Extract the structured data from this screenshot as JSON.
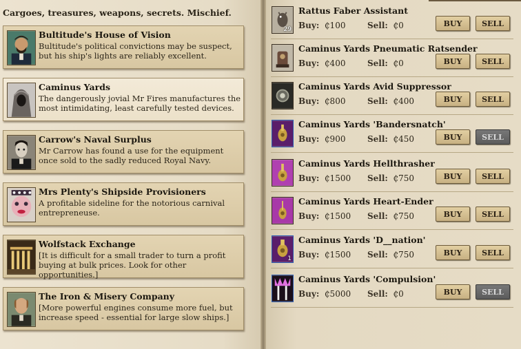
{
  "tagline": "Cargoes, treasures, weapons, secrets. Mischief.",
  "shops": [
    {
      "name": "Bultitude's House of Vision",
      "desc": "Bultitude's political convictions may be suspect, but his ship's lights are reliably excellent.",
      "portrait": "bearded-man-portrait"
    },
    {
      "name": "Caminus Yards",
      "desc": "The dangerously jovial Mr Fires manufactures the most intimidating, least carefully tested devices.",
      "portrait": "hooded-figure-portrait"
    },
    {
      "name": "Carrow's Naval Surplus",
      "desc": "Mr Carrow has found a use for the equipment once sold to the sadly reduced Royal Navy.",
      "portrait": "pale-man-portrait"
    },
    {
      "name": "Mrs Plenty's Shipside Provisioners",
      "desc": "A profitable sideline for the notorious carnival entrepreneuse.",
      "portrait": "clown-woman-portrait"
    },
    {
      "name": "Wolfstack Exchange",
      "desc": "[It is difficult for a small trader to turn a profit buying at bulk prices. Look for other opportunities.]",
      "portrait": "exchange-building-portrait"
    },
    {
      "name": "The Iron & Misery Company",
      "desc": "[More powerful engines consume more fuel, but increase speed - essential for large slow ships.]",
      "portrait": "balding-man-portrait"
    }
  ],
  "labels": {
    "buy": "Buy:",
    "sell": "Sell:",
    "buy_btn": "BUY",
    "sell_btn": "SELL"
  },
  "items": [
    {
      "name": "Rattus Faber Assistant",
      "buy": "₵100",
      "sell": "₵0",
      "qty": "29",
      "icon": "rat-assistant-icon",
      "sell_enabled": true
    },
    {
      "name": "Caminus Yards Pneumatic Ratsender",
      "buy": "₵400",
      "sell": "₵0",
      "qty": "",
      "icon": "ratsender-icon",
      "sell_enabled": true
    },
    {
      "name": "Caminus Yards Avid Suppressor",
      "buy": "₵800",
      "sell": "₵400",
      "qty": "",
      "icon": "suppressor-icon",
      "sell_enabled": true
    },
    {
      "name": "Caminus Yards 'Bandersnatch'",
      "buy": "₵900",
      "sell": "₵450",
      "qty": "",
      "icon": "bandersnatch-icon",
      "sell_enabled": false
    },
    {
      "name": "Caminus Yards Hellthrasher",
      "buy": "₵1500",
      "sell": "₵750",
      "qty": "",
      "icon": "hellthrasher-icon",
      "sell_enabled": true
    },
    {
      "name": "Caminus Yards Heart-Ender",
      "buy": "₵1500",
      "sell": "₵750",
      "qty": "",
      "icon": "heart-ender-icon",
      "sell_enabled": true
    },
    {
      "name": "Caminus Yards 'D__nation'",
      "buy": "₵1500",
      "sell": "₵750",
      "qty": "1",
      "icon": "damnation-icon",
      "sell_enabled": true
    },
    {
      "name": "Caminus Yards 'Compulsion'",
      "buy": "₵5000",
      "sell": "₵0",
      "qty": "",
      "icon": "compulsion-icon",
      "sell_enabled": false
    }
  ]
}
